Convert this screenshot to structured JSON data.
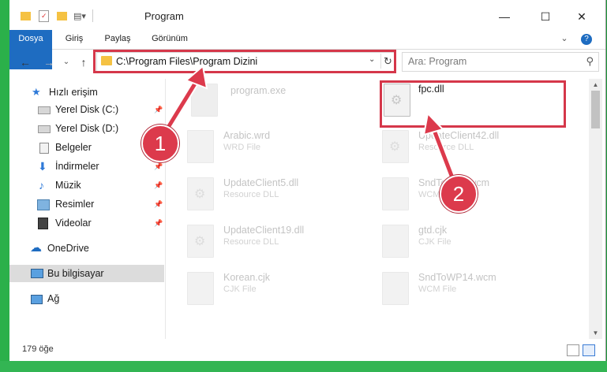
{
  "window": {
    "title": "Program",
    "minimize_glyph": "—",
    "maximize_glyph": "☐",
    "close_glyph": "✕"
  },
  "ribbon": {
    "tabs": [
      {
        "label": "Dosya",
        "active": true
      },
      {
        "label": "Giriş"
      },
      {
        "label": "Paylaş"
      },
      {
        "label": "Görünüm"
      }
    ],
    "help_glyph": "?",
    "expand_glyph": "⌄"
  },
  "navigation": {
    "back_glyph": "←",
    "forward_glyph": "→",
    "recent_glyph": "⌄",
    "up_glyph": "↑"
  },
  "address_bar": {
    "path": "C:\\Program Files\\Program Dizini",
    "dropdown_glyph": "⌄",
    "refresh_glyph": "↻"
  },
  "search": {
    "placeholder": "Ara: Program",
    "icon": "search-icon",
    "glyph": "⚲"
  },
  "sidebar": {
    "items": [
      {
        "label": "Hızlı erişim",
        "icon": "star-icon",
        "pinned": false
      },
      {
        "label": "Yerel Disk (C:)",
        "icon": "drive-icon",
        "pinned": true
      },
      {
        "label": "Yerel Disk (D:)",
        "icon": "drive-icon",
        "pinned": false
      },
      {
        "label": "Belgeler",
        "icon": "documents-icon",
        "pinned": true
      },
      {
        "label": "İndirmeler",
        "icon": "download-icon",
        "pinned": true
      },
      {
        "label": "Müzik",
        "icon": "music-icon",
        "pinned": true
      },
      {
        "label": "Resimler",
        "icon": "pictures-icon",
        "pinned": true
      },
      {
        "label": "Videolar",
        "icon": "video-icon",
        "pinned": true
      },
      {
        "label": "OneDrive",
        "icon": "cloud-icon",
        "pinned": false
      },
      {
        "label": "Bu bilgisayar",
        "icon": "computer-icon",
        "pinned": false,
        "selected": true
      },
      {
        "label": "Ağ",
        "icon": "network-icon",
        "pinned": false
      }
    ],
    "pin_glyph": "📌"
  },
  "files": [
    {
      "name": "program.exe",
      "type": ""
    },
    {
      "name": "fpc.dll",
      "type": "",
      "highlighted": true
    },
    {
      "name": "Arabic.wrd",
      "type": "WRD File"
    },
    {
      "name": "UpdateClient42.dll",
      "type": "Resource DLL"
    },
    {
      "name": "UpdateClient5.dll",
      "type": "Resource DLL"
    },
    {
      "name": "SndToWP...wcm",
      "type": "WCM File"
    },
    {
      "name": "UpdateClient19.dll",
      "type": "Resource DLL"
    },
    {
      "name": "gtd.cjk",
      "type": "CJK File"
    },
    {
      "name": "Korean.cjk",
      "type": "CJK File"
    },
    {
      "name": "SndToWP14.wcm",
      "type": "WCM File"
    }
  ],
  "status_bar": {
    "item_count": "179 öğe"
  },
  "annotations": {
    "step1": "1",
    "step2": "2",
    "color": "#dc3a4c"
  },
  "colors": {
    "accent": "#1e6cc1",
    "frame": "#1d9a3c"
  }
}
